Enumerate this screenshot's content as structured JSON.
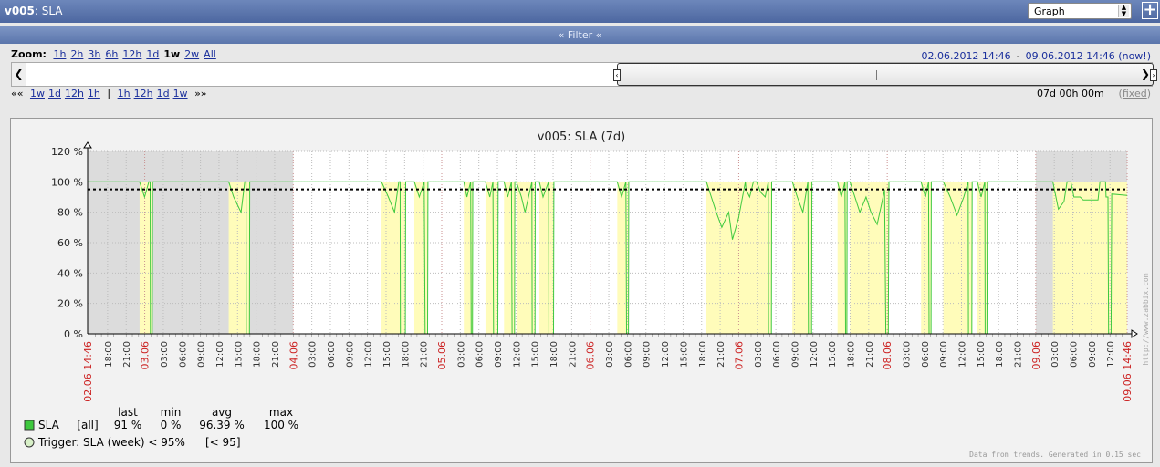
{
  "header": {
    "host_link": "v005",
    "title_rest": ": SLA",
    "view_select": "Graph",
    "fullscreen_glyph": "+"
  },
  "filter": {
    "label": "Filter",
    "icon": "chevron-up-double-icon"
  },
  "zoom": {
    "label": "Zoom:",
    "options": [
      "1h",
      "2h",
      "3h",
      "6h",
      "12h",
      "1d",
      "1w",
      "2w",
      "All"
    ],
    "active": "1w",
    "from": "02.06.2012 14:46",
    "separator": "-",
    "to": "09.06.2012 14:46 (now!)"
  },
  "navigation": {
    "back_all": "««",
    "back": [
      "1w",
      "1d",
      "12h",
      "1h"
    ],
    "divider": "|",
    "forward": [
      "1h",
      "12h",
      "1d",
      "1w"
    ],
    "forward_all": "»»",
    "period_length": "07d 00h 00m",
    "fixed_label": "fixed"
  },
  "colors": {
    "series_line": "#3ec93e",
    "problem_fill": "#fffcba",
    "night_shade": "#dcdcdc",
    "date_label": "#cc2222",
    "grid": "#bcbcbc"
  },
  "chart_data": {
    "type": "area",
    "title": "v005: SLA  (7d)",
    "ylim": [
      0,
      120
    ],
    "y_ticks": [
      "0 %",
      "20 %",
      "40 %",
      "60 %",
      "80 %",
      "100 %",
      "120 %"
    ],
    "x_range_hours": [
      0,
      168
    ],
    "x_tick_labels": [
      {
        "h": 0,
        "label": "02.06 14:46",
        "date": true
      },
      {
        "h": 3.23,
        "label": "18:00"
      },
      {
        "h": 6.23,
        "label": "21:00"
      },
      {
        "h": 9.23,
        "label": "03.06",
        "date": true
      },
      {
        "h": 12.23,
        "label": "03:00"
      },
      {
        "h": 15.23,
        "label": "06:00"
      },
      {
        "h": 18.23,
        "label": "09:00"
      },
      {
        "h": 21.23,
        "label": "12:00"
      },
      {
        "h": 24.23,
        "label": "15:00"
      },
      {
        "h": 27.23,
        "label": "18:00"
      },
      {
        "h": 30.23,
        "label": "21:00"
      },
      {
        "h": 33.23,
        "label": "04.06",
        "date": true
      },
      {
        "h": 36.23,
        "label": "03:00"
      },
      {
        "h": 39.23,
        "label": "06:00"
      },
      {
        "h": 42.23,
        "label": "09:00"
      },
      {
        "h": 45.23,
        "label": "12:00"
      },
      {
        "h": 48.23,
        "label": "15:00"
      },
      {
        "h": 51.23,
        "label": "18:00"
      },
      {
        "h": 54.23,
        "label": "21:00"
      },
      {
        "h": 57.23,
        "label": "05.06",
        "date": true
      },
      {
        "h": 60.23,
        "label": "03:00"
      },
      {
        "h": 63.23,
        "label": "06:00"
      },
      {
        "h": 66.23,
        "label": "09:00"
      },
      {
        "h": 69.23,
        "label": "12:00"
      },
      {
        "h": 72.23,
        "label": "15:00"
      },
      {
        "h": 75.23,
        "label": "18:00"
      },
      {
        "h": 78.23,
        "label": "21:00"
      },
      {
        "h": 81.23,
        "label": "06.06",
        "date": true
      },
      {
        "h": 84.23,
        "label": "03:00"
      },
      {
        "h": 87.23,
        "label": "06:00"
      },
      {
        "h": 90.23,
        "label": "09:00"
      },
      {
        "h": 93.23,
        "label": "12:00"
      },
      {
        "h": 96.23,
        "label": "15:00"
      },
      {
        "h": 99.23,
        "label": "18:00"
      },
      {
        "h": 102.23,
        "label": "21:00"
      },
      {
        "h": 105.23,
        "label": "07.06",
        "date": true
      },
      {
        "h": 108.23,
        "label": "03:00"
      },
      {
        "h": 111.23,
        "label": "06:00"
      },
      {
        "h": 114.23,
        "label": "09:00"
      },
      {
        "h": 117.23,
        "label": "12:00"
      },
      {
        "h": 120.23,
        "label": "15:00"
      },
      {
        "h": 123.23,
        "label": "18:00"
      },
      {
        "h": 126.23,
        "label": "21:00"
      },
      {
        "h": 129.23,
        "label": "08.06",
        "date": true
      },
      {
        "h": 132.23,
        "label": "03:00"
      },
      {
        "h": 135.23,
        "label": "06:00"
      },
      {
        "h": 138.23,
        "label": "09:00"
      },
      {
        "h": 141.23,
        "label": "12:00"
      },
      {
        "h": 144.23,
        "label": "15:00"
      },
      {
        "h": 147.23,
        "label": "18:00"
      },
      {
        "h": 150.23,
        "label": "21:00"
      },
      {
        "h": 153.23,
        "label": "09.06",
        "date": true
      },
      {
        "h": 156.23,
        "label": "03:00"
      },
      {
        "h": 159.23,
        "label": "06:00"
      },
      {
        "h": 162.23,
        "label": "09:00"
      },
      {
        "h": 165.23,
        "label": "12:00"
      },
      {
        "h": 168,
        "label": "09.06 14:46",
        "date": true
      }
    ],
    "shaded_ranges_hours": [
      [
        0,
        33.23
      ],
      [
        153.23,
        168
      ]
    ],
    "trigger_threshold": 95,
    "series": [
      {
        "name": "SLA",
        "points": [
          [
            0,
            100
          ],
          [
            8.4,
            100
          ],
          [
            9.2,
            90
          ],
          [
            9.9,
            100
          ],
          [
            10.1,
            100
          ],
          [
            10.15,
            0
          ],
          [
            10.45,
            0
          ],
          [
            10.5,
            100
          ],
          [
            22.8,
            100
          ],
          [
            23.6,
            90
          ],
          [
            24.8,
            80
          ],
          [
            25.4,
            100
          ],
          [
            25.6,
            100
          ],
          [
            25.65,
            0
          ],
          [
            26.15,
            0
          ],
          [
            26.2,
            100
          ],
          [
            47.5,
            100
          ],
          [
            48.6,
            90
          ],
          [
            49.6,
            80
          ],
          [
            50.3,
            100
          ],
          [
            50.5,
            100
          ],
          [
            50.55,
            0
          ],
          [
            51.35,
            0
          ],
          [
            51.4,
            100
          ],
          [
            52.8,
            100
          ],
          [
            53.6,
            90
          ],
          [
            54.4,
            100
          ],
          [
            54.55,
            0
          ],
          [
            54.95,
            0
          ],
          [
            55.0,
            100
          ],
          [
            60.8,
            100
          ],
          [
            61.3,
            90
          ],
          [
            61.9,
            100
          ],
          [
            62.0,
            0
          ],
          [
            62.2,
            0
          ],
          [
            62.25,
            100
          ],
          [
            64.3,
            100
          ],
          [
            65.0,
            90
          ],
          [
            65.5,
            100
          ],
          [
            65.6,
            0
          ],
          [
            66.3,
            0
          ],
          [
            66.35,
            100
          ],
          [
            67.3,
            100
          ],
          [
            67.9,
            90
          ],
          [
            68.5,
            100
          ],
          [
            68.6,
            0
          ],
          [
            69.0,
            0
          ],
          [
            69.05,
            100
          ],
          [
            69.3,
            100
          ],
          [
            70.1,
            90
          ],
          [
            70.7,
            80
          ],
          [
            71.8,
            100
          ],
          [
            71.85,
            0
          ],
          [
            72.3,
            0
          ],
          [
            72.35,
            100
          ],
          [
            73.0,
            100
          ],
          [
            73.6,
            90
          ],
          [
            74.5,
            100
          ],
          [
            74.55,
            0
          ],
          [
            75.3,
            0
          ],
          [
            75.35,
            100
          ],
          [
            85.6,
            100
          ],
          [
            86.3,
            90
          ],
          [
            87.0,
            100
          ],
          [
            87.1,
            0
          ],
          [
            87.4,
            0
          ],
          [
            87.45,
            100
          ],
          [
            100.0,
            100
          ],
          [
            100.8,
            90
          ],
          [
            101.6,
            80
          ],
          [
            102.5,
            70
          ],
          [
            103.6,
            80
          ],
          [
            104.2,
            62
          ],
          [
            105.2,
            76
          ],
          [
            106.3,
            100
          ],
          [
            106.4,
            95
          ],
          [
            107.0,
            90
          ],
          [
            107.6,
            100
          ],
          [
            108.1,
            100
          ],
          [
            108.8,
            93
          ],
          [
            109.5,
            90
          ],
          [
            110.0,
            100
          ],
          [
            110.05,
            0
          ],
          [
            110.5,
            0
          ],
          [
            110.55,
            100
          ],
          [
            113.9,
            100
          ],
          [
            114.7,
            90
          ],
          [
            115.6,
            80
          ],
          [
            116.4,
            100
          ],
          [
            116.5,
            0
          ],
          [
            117.0,
            0
          ],
          [
            117.05,
            100
          ],
          [
            121.2,
            100
          ],
          [
            121.8,
            90
          ],
          [
            122.4,
            100
          ],
          [
            122.5,
            0
          ],
          [
            122.7,
            0
          ],
          [
            122.75,
            100
          ],
          [
            123.2,
            100
          ],
          [
            124.0,
            90
          ],
          [
            124.8,
            80
          ],
          [
            125.8,
            90
          ],
          [
            126.6,
            80
          ],
          [
            127.6,
            72
          ],
          [
            128.3,
            85
          ],
          [
            128.8,
            95
          ],
          [
            129.0,
            0
          ],
          [
            129.4,
            0
          ],
          [
            129.5,
            100
          ],
          [
            134.7,
            100
          ],
          [
            135.4,
            90
          ],
          [
            135.9,
            100
          ],
          [
            136.0,
            0
          ],
          [
            136.3,
            0
          ],
          [
            136.35,
            100
          ],
          [
            138.3,
            100
          ],
          [
            139.4,
            90
          ],
          [
            140.5,
            78
          ],
          [
            141.6,
            90
          ],
          [
            142.3,
            100
          ],
          [
            142.35,
            0
          ],
          [
            142.9,
            0
          ],
          [
            142.95,
            100
          ],
          [
            143.8,
            100
          ],
          [
            144.4,
            90
          ],
          [
            145.0,
            100
          ],
          [
            145.05,
            0
          ],
          [
            145.35,
            0
          ],
          [
            145.4,
            100
          ],
          [
            156.0,
            100
          ],
          [
            156.9,
            82
          ],
          [
            157.8,
            87
          ],
          [
            158.3,
            100
          ],
          [
            158.9,
            100
          ],
          [
            159.4,
            90
          ],
          [
            160.4,
            90
          ],
          [
            160.9,
            88
          ],
          [
            163.3,
            88
          ],
          [
            163.6,
            100
          ],
          [
            164.0,
            100
          ],
          [
            164.5,
            100
          ],
          [
            164.6,
            90
          ],
          [
            164.9,
            90
          ],
          [
            165.0,
            0
          ],
          [
            165.4,
            0
          ],
          [
            165.5,
            92
          ],
          [
            168,
            91
          ]
        ]
      }
    ],
    "problem_ranges_hours": [
      [
        8.4,
        10.5
      ],
      [
        22.8,
        26.2
      ],
      [
        47.5,
        51.4
      ],
      [
        52.8,
        55.0
      ],
      [
        60.8,
        62.25
      ],
      [
        64.3,
        66.35
      ],
      [
        67.3,
        69.05
      ],
      [
        69.3,
        72.35
      ],
      [
        73.0,
        75.35
      ],
      [
        85.6,
        87.45
      ],
      [
        100.0,
        110.55
      ],
      [
        113.9,
        117.05
      ],
      [
        121.2,
        122.75
      ],
      [
        123.2,
        129.5
      ],
      [
        134.7,
        136.35
      ],
      [
        138.3,
        142.95
      ],
      [
        143.8,
        145.4
      ],
      [
        156.0,
        168
      ]
    ],
    "legend_header": {
      "last": "last",
      "min": "min",
      "avg": "avg",
      "max": "max"
    },
    "legend": [
      {
        "name": "SLA",
        "func": "[all]",
        "last": "91 %",
        "min": "0 %",
        "avg": "96.39 %",
        "max": "100 %"
      }
    ],
    "trigger_legend": {
      "name": "Trigger: SLA (week) < 95%",
      "condition": "[< 95]"
    },
    "footer_note": "Data from trends. Generated in 0.15 sec",
    "watermark": "http://www.zabbix.com"
  }
}
